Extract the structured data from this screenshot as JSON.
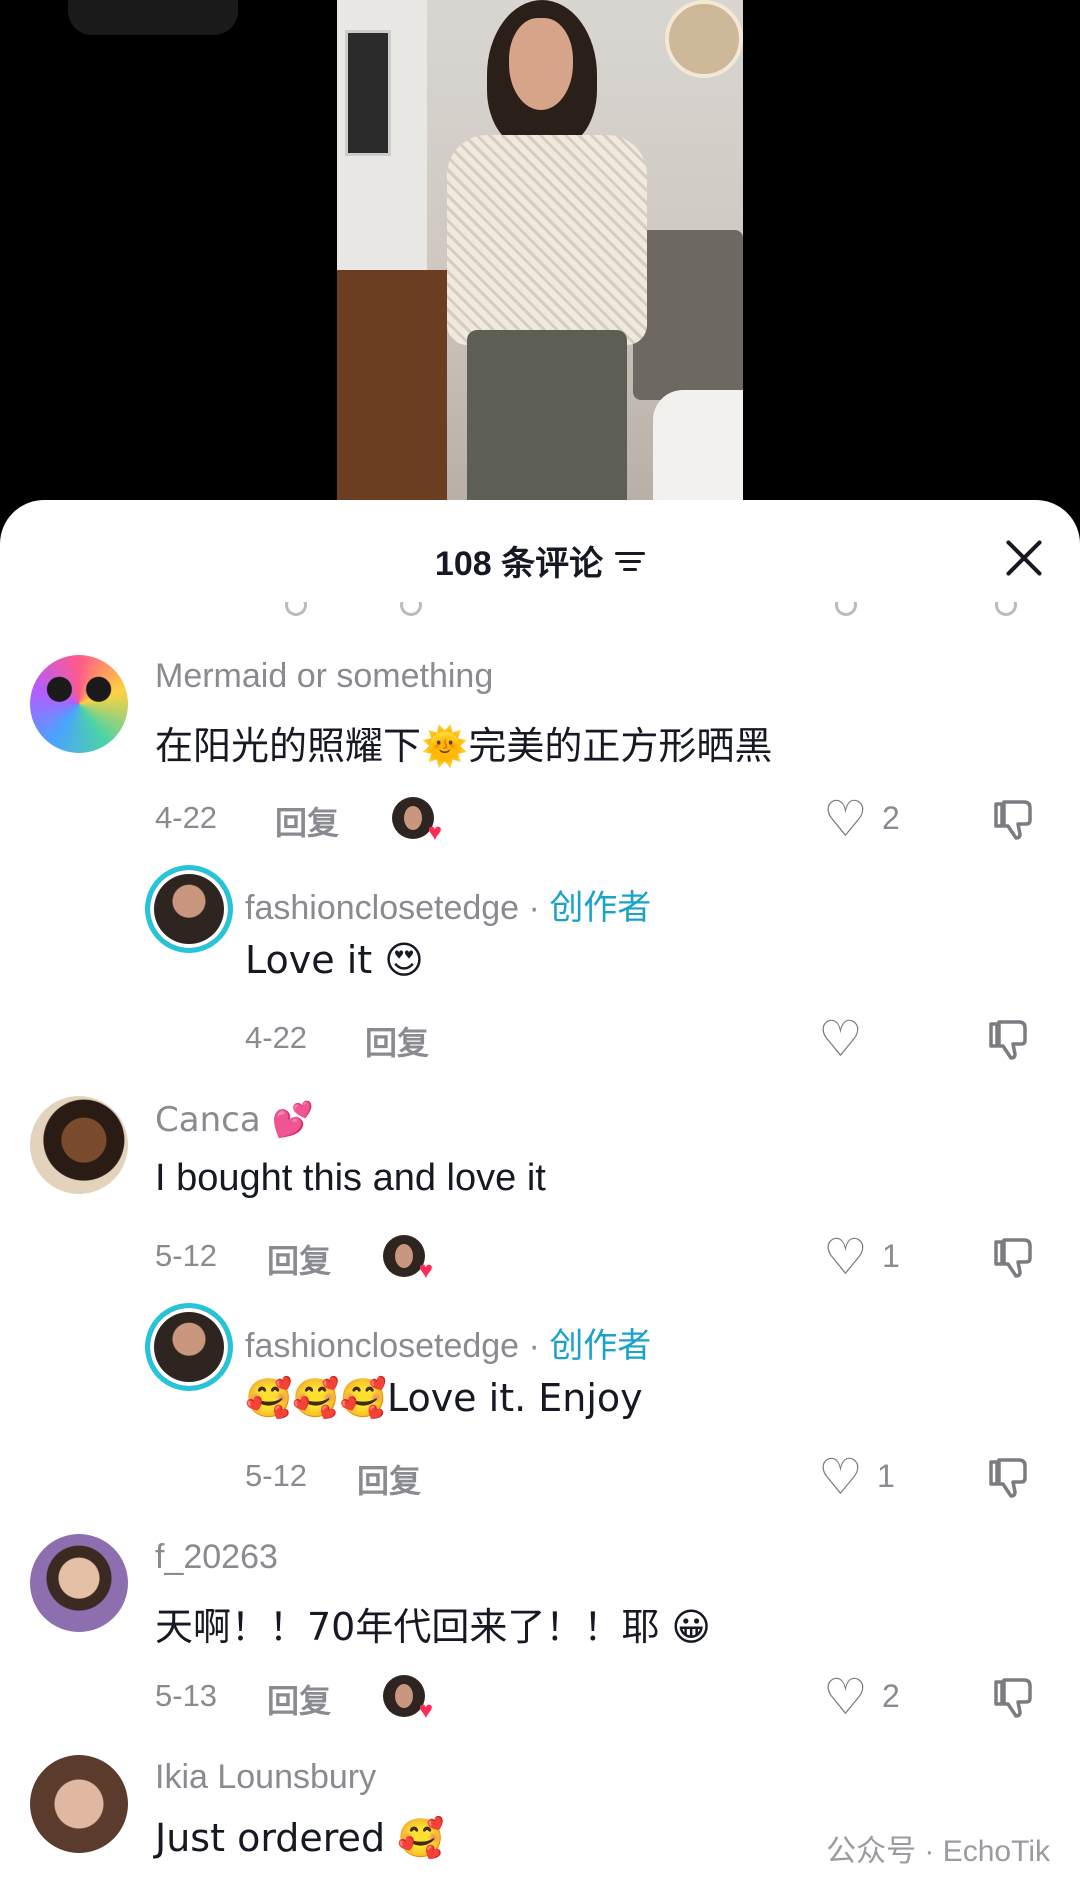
{
  "header": {
    "title": "108 条评论"
  },
  "comments": [
    {
      "username": "Mermaid or something",
      "text": "在阳光的照耀下🌞完美的正方形晒黑",
      "date": "4-22",
      "reply": "回复",
      "likes": "2",
      "avatar_color": "#e8e4dc"
    },
    {
      "username": "fashionclosetedge · ",
      "creator_tag": "创作者",
      "text": "Love it 😍",
      "date": "4-22",
      "reply": "回复",
      "likes": ""
    },
    {
      "username": "Canca 💕",
      "text": "I bought this and love it",
      "date": "5-12",
      "reply": "回复",
      "likes": "1",
      "avatar_color": "#c49a6c"
    },
    {
      "username": "fashionclosetedge · ",
      "creator_tag": "创作者",
      "text": "🥰🥰🥰Love it. Enjoy",
      "date": "5-12",
      "reply": "回复",
      "likes": "1"
    },
    {
      "username": "f_20263",
      "text": "天啊！！70年代回来了！！耶 😀",
      "date": "5-13",
      "reply": "回复",
      "likes": "2",
      "avatar_color": "#8d6fb0"
    },
    {
      "username": "Ikia Lounsbury",
      "text": "Just ordered 🥰",
      "avatar_color": "#d9b8a6"
    }
  ],
  "watermark": "公众号 · EchoTik",
  "colors": {
    "accent_creator": "#1aa2c8",
    "like_heart": "#fe2c55",
    "ring": "#25c4d9"
  }
}
